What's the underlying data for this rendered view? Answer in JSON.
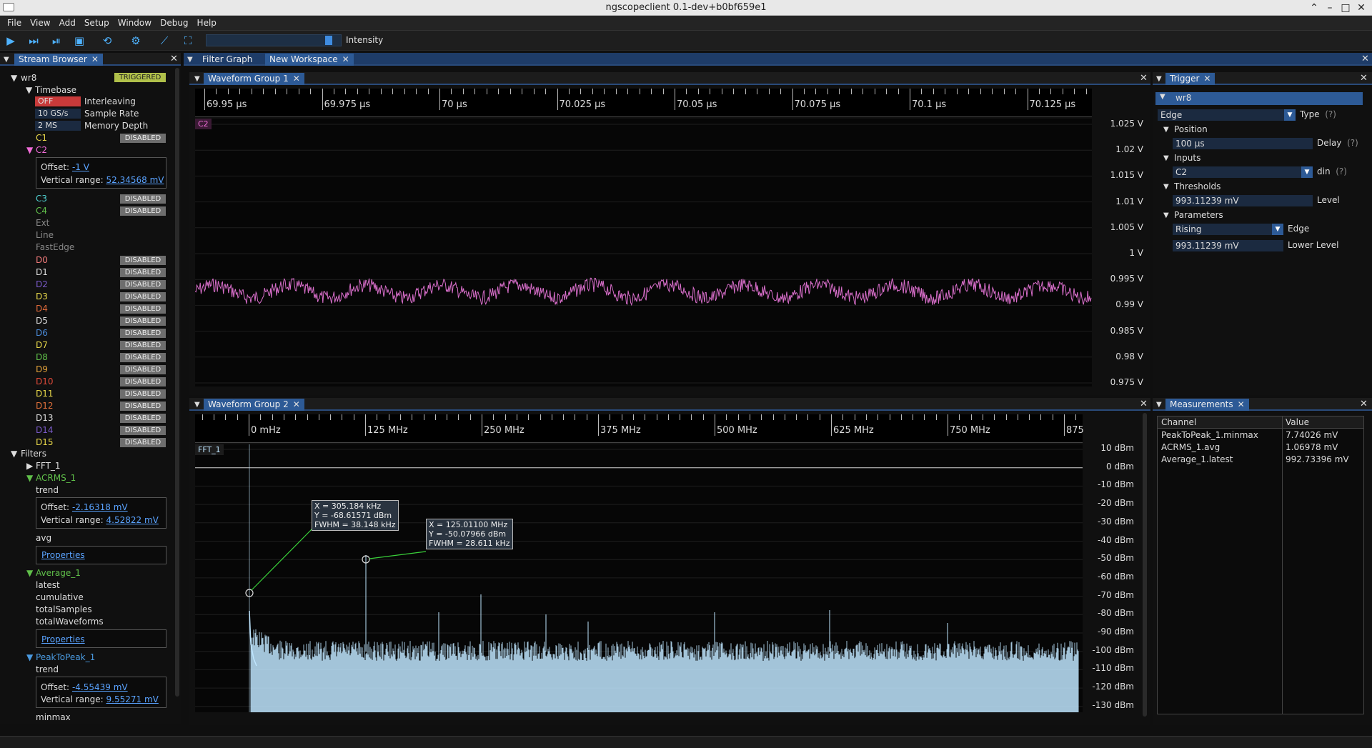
{
  "window": {
    "title": "ngscopeclient 0.1-dev+b0bf659e1",
    "controls": [
      "⌃",
      "–",
      "□",
      "✕"
    ]
  },
  "menu": [
    "File",
    "View",
    "Add",
    "Setup",
    "Window",
    "Debug",
    "Help"
  ],
  "toolbar": {
    "intensity_label": "Intensity",
    "intensity_level": 0.93,
    "buttons": [
      "start-icon",
      "single-icon",
      "force-icon",
      "autoscale-icon",
      "sync-icon",
      "settings-icon",
      "measure-icon",
      "fit-icon"
    ]
  },
  "stream_browser": {
    "tab": "Stream Browser",
    "device": "wr8",
    "state": "TRIGGERED",
    "timebase_label": "Timebase",
    "timebase": [
      {
        "value": "OFF",
        "label": "Interleaving",
        "color": "#c83a3a"
      },
      {
        "value": "10 GS/s",
        "label": "Sample Rate",
        "color": "#1b2a40"
      },
      {
        "value": "2 MS",
        "label": "Memory Depth",
        "color": "#1b2a40"
      }
    ],
    "disabled": "DISABLED",
    "c1": {
      "name": "C1",
      "color": "#e8d84a"
    },
    "c2": {
      "name": "C2",
      "color": "#f06cd8",
      "offset_label": "Offset:",
      "offset": "-1 V",
      "range_label": "Vertical range:",
      "range": "52.34568 mV"
    },
    "c3": {
      "name": "C3",
      "color": "#4fd0d0"
    },
    "c4": {
      "name": "C4",
      "color": "#60c04a"
    },
    "others": [
      "Ext",
      "Line",
      "FastEdge"
    ],
    "digital": [
      {
        "n": "D0",
        "c": "#f07a7a"
      },
      {
        "n": "D1",
        "c": "#dddddd"
      },
      {
        "n": "D2",
        "c": "#7a5ac8"
      },
      {
        "n": "D3",
        "c": "#e8d84a"
      },
      {
        "n": "D4",
        "c": "#e06a3a"
      },
      {
        "n": "D5",
        "c": "#dddddd"
      },
      {
        "n": "D6",
        "c": "#4a8ad8"
      },
      {
        "n": "D7",
        "c": "#e8d84a"
      },
      {
        "n": "D8",
        "c": "#60c04a"
      },
      {
        "n": "D9",
        "c": "#e0a03a"
      },
      {
        "n": "D10",
        "c": "#e04a3a"
      },
      {
        "n": "D11",
        "c": "#e8d84a"
      },
      {
        "n": "D12",
        "c": "#e0703a"
      },
      {
        "n": "D13",
        "c": "#dddddd"
      },
      {
        "n": "D14",
        "c": "#7a5ac8"
      },
      {
        "n": "D15",
        "c": "#e8d84a"
      }
    ],
    "filters_label": "Filters",
    "fft": "FFT_1",
    "acrms": {
      "name": "ACRMS_1",
      "color": "#60c04a",
      "stream1": "trend",
      "offset": "-2.16318 mV",
      "range": "4.52822 mV",
      "stream2": "avg",
      "props": "Properties"
    },
    "avg": {
      "name": "Average_1",
      "color": "#60c04a",
      "streams": [
        "latest",
        "cumulative",
        "totalSamples",
        "totalWaveforms"
      ],
      "props": "Properties"
    },
    "p2p": {
      "name": "PeakToPeak_1",
      "color": "#4a9ae0",
      "stream1": "trend",
      "offset": "-4.55439 mV",
      "range": "9.55271 mV",
      "stream2": "minmax"
    }
  },
  "workspace_tabs": {
    "filter_graph": "Filter Graph",
    "new_workspace": "New Workspace"
  },
  "group1": {
    "tab": "Waveform Group 1",
    "channel": "C2",
    "xticks": [
      "69.95 µs",
      "69.975 µs",
      "70 µs",
      "70.025 µs",
      "70.05 µs",
      "70.075 µs",
      "70.1 µs",
      "70.125 µs"
    ],
    "yticks": [
      "1.025 V",
      "1.02 V",
      "1.015 V",
      "1.01 V",
      "1.005 V",
      "1 V",
      "0.995 V",
      "0.99 V",
      "0.985 V",
      "0.98 V",
      "0.975 V"
    ],
    "trace_color": "#f07ae0"
  },
  "group2": {
    "tab": "Waveform Group 2",
    "channel": "FFT_1",
    "xticks": [
      "0 mHz",
      "125 MHz",
      "250 MHz",
      "375 MHz",
      "500 MHz",
      "625 MHz",
      "750 MHz",
      "875"
    ],
    "yticks": [
      "10 dBm",
      "0 dBm",
      "-10 dBm",
      "-20 dBm",
      "-30 dBm",
      "-40 dBm",
      "-50 dBm",
      "-60 dBm",
      "-70 dBm",
      "-80 dBm",
      "-90 dBm",
      "-100 dBm",
      "-110 dBm",
      "-120 dBm",
      "-130 dBm"
    ],
    "cursor1": [
      "X = 305.184 kHz",
      "Y = -68.61571 dBm",
      "FWHM = 38.148 kHz"
    ],
    "cursor2": [
      "X = 125.01100 MHz",
      "Y = -50.07966 dBm",
      "FWHM = 28.611 kHz"
    ],
    "trace_color": "#bfe6ff"
  },
  "trigger": {
    "tab": "Trigger",
    "device": "wr8",
    "type_value": "Edge",
    "type_label": "Type",
    "help": "(?)",
    "position_label": "Position",
    "delay_value": "100 µs",
    "delay_label": "Delay",
    "inputs_label": "Inputs",
    "din_value": "C2",
    "din_label": "din",
    "thresholds_label": "Thresholds",
    "level_value": "993.11239 mV",
    "level_label": "Level",
    "parameters_label": "Parameters",
    "edge_value": "Rising",
    "edge_label": "Edge",
    "lower_value": "993.11239 mV",
    "lower_label": "Lower Level"
  },
  "measurements": {
    "tab": "Measurements",
    "col_channel": "Channel",
    "col_value": "Value",
    "rows": [
      {
        "ch": "PeakToPeak_1.minmax",
        "v": "7.74026 mV"
      },
      {
        "ch": "ACRMS_1.avg",
        "v": "1.06978 mV"
      },
      {
        "ch": "Average_1.latest",
        "v": "992.73396 mV"
      }
    ]
  }
}
